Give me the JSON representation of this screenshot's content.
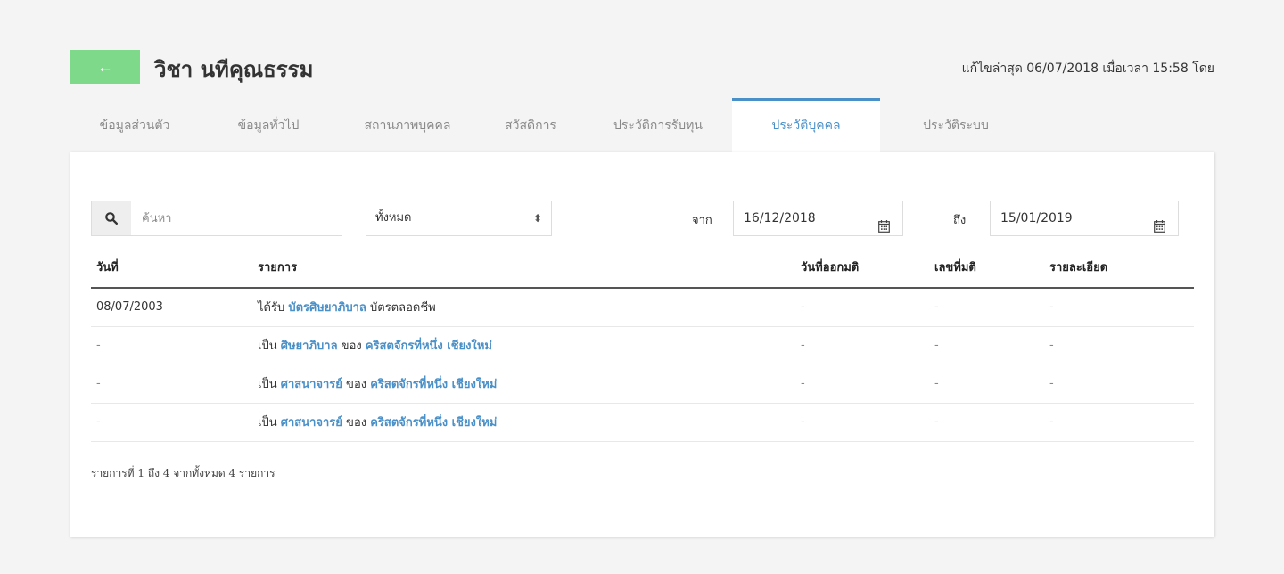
{
  "header": {
    "back_icon": "←",
    "title": "วิชา นทีคุณธรรม",
    "last_edit": "แก้ไขล่าสุด 06/07/2018 เมื่อเวลา 15:58 โดย"
  },
  "tabs": [
    {
      "label": "ข้อมูลส่วนตัว",
      "active": false
    },
    {
      "label": "ข้อมูลทั่วไป",
      "active": false
    },
    {
      "label": "สถานภาพบุคคล",
      "active": false
    },
    {
      "label": "สวัสดิการ",
      "active": false
    },
    {
      "label": "ประวัติการรับทุน",
      "active": false
    },
    {
      "label": "ประวัติบุคคล",
      "active": true
    },
    {
      "label": "ประวัติระบบ",
      "active": false
    }
  ],
  "filters": {
    "search_placeholder": "ค้นหา",
    "search_value": "",
    "select_value": "ทั้งหมด",
    "from_label": "จาก",
    "from_date": "16/12/2018",
    "to_label": "ถึง",
    "to_date": "15/01/2019"
  },
  "table": {
    "columns": [
      "วันที่",
      "รายการ",
      "วันที่ออกมติ",
      "เลขที่มติ",
      "รายละเอียด"
    ],
    "rows": [
      {
        "date": "08/07/2003",
        "parts": [
          {
            "t": "ได้รับ ",
            "link": false
          },
          {
            "t": "บัตรศิษยาภิบาล",
            "link": true
          },
          {
            "t": " บัตรตลอดชีพ",
            "link": false
          }
        ],
        "issued": "-",
        "number": "-",
        "detail": "-"
      },
      {
        "date": "-",
        "parts": [
          {
            "t": "เป็น ",
            "link": false
          },
          {
            "t": "ศิษยาภิบาล",
            "link": true
          },
          {
            "t": " ของ ",
            "link": false
          },
          {
            "t": "คริสตจักรที่หนึ่ง เชียงใหม่",
            "link": true
          }
        ],
        "issued": "-",
        "number": "-",
        "detail": "-"
      },
      {
        "date": "-",
        "parts": [
          {
            "t": "เป็น ",
            "link": false
          },
          {
            "t": "ศาสนาจารย์",
            "link": true
          },
          {
            "t": " ของ ",
            "link": false
          },
          {
            "t": "คริสตจักรที่หนึ่ง เชียงใหม่",
            "link": true
          }
        ],
        "issued": "-",
        "number": "-",
        "detail": "-"
      },
      {
        "date": "-",
        "parts": [
          {
            "t": "เป็น ",
            "link": false
          },
          {
            "t": "ศาสนาจารย์",
            "link": true
          },
          {
            "t": " ของ ",
            "link": false
          },
          {
            "t": "คริสตจักรที่หนึ่ง เชียงใหม่",
            "link": true
          }
        ],
        "issued": "-",
        "number": "-",
        "detail": "-"
      }
    ]
  },
  "summary": "รายการที่ 1 ถึง 4 จากทั้งหมด 4 รายการ",
  "colors": {
    "accent": "#4a90c8",
    "back_button": "#7fd98a"
  }
}
